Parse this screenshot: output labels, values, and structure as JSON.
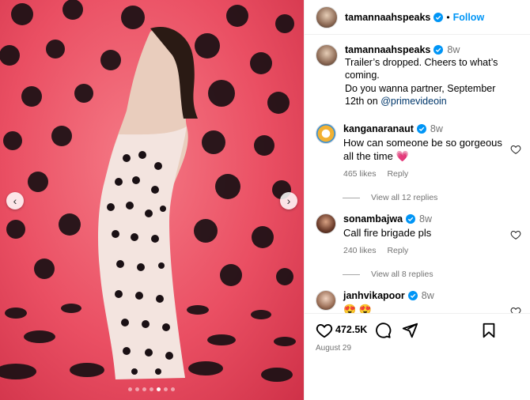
{
  "post": {
    "author": "tamannaahspeaks",
    "follow_label": "Follow",
    "bullet": "•",
    "media": {
      "slides": 7,
      "active_slide": 5
    },
    "caption": {
      "user": "tamannaahspeaks",
      "time": "8w",
      "line1": "Trailer’s dropped. Cheers to what’s coming.",
      "line2": "Do you wanna partner, September 12th on",
      "mention": "@primevideoin"
    },
    "likes": "472.5K",
    "date": "August 29"
  },
  "comments": [
    {
      "user": "kanganaranaut",
      "time": "8w",
      "text": "How can someone be so gorgeous all the time",
      "emoji": "💗",
      "likes": "465 likes",
      "reply_label": "Reply",
      "view_replies": "View all 12 replies"
    },
    {
      "user": "sonambajwa",
      "time": "8w",
      "text": "Call fire brigade pls",
      "likes": "240 likes",
      "reply_label": "Reply",
      "view_replies": "View all 8 replies"
    },
    {
      "user": "janhvikapoor",
      "time": "8w",
      "text": "😍 😍"
    }
  ],
  "icons": {
    "verified": "verified-badge-icon",
    "like": "heart-icon",
    "comment": "comment-bubble-icon",
    "share": "paper-plane-icon",
    "save": "bookmark-icon",
    "prev": "chevron-left-icon",
    "next": "chevron-right-icon"
  },
  "colors": {
    "link": "#0095f6",
    "mention": "#00376b",
    "muted": "#737373",
    "backdrop": "#ea4f63",
    "emoji_heart": "#ff3b7f"
  }
}
